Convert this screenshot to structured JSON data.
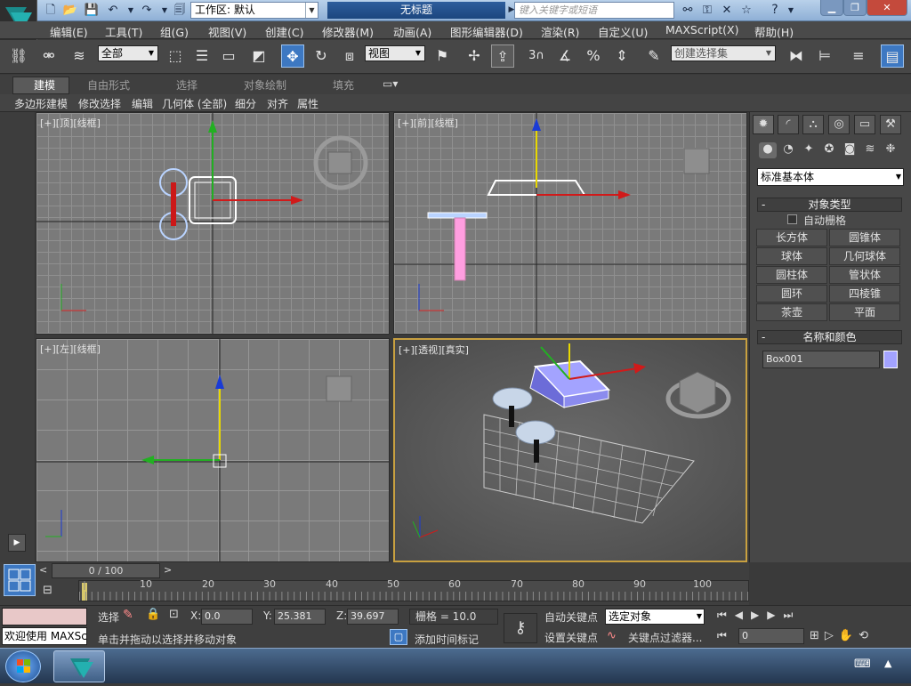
{
  "titlebar": {
    "workspace_label": "工作区: 默认",
    "doc_title": "无标题",
    "search_placeholder": "键入关键字或短语"
  },
  "menu": [
    "编辑(E)",
    "工具(T)",
    "组(G)",
    "视图(V)",
    "创建(C)",
    "修改器(M)",
    "动画(A)",
    "图形编辑器(D)",
    "渲染(R)",
    "自定义(U)",
    "MAXScript(X)",
    "帮助(H)"
  ],
  "toolbar": {
    "filter_select": "全部",
    "refcoord_select": "视图",
    "snap_label": "3",
    "selset_placeholder": "创建选择集"
  },
  "ribbon": {
    "tabs": [
      "建模",
      "自由形式",
      "选择",
      "对象绘制",
      "填充"
    ],
    "subtabs": [
      "多边形建模",
      "修改选择",
      "编辑",
      "几何体 (全部)",
      "细分",
      "对齐",
      "属性"
    ]
  },
  "viewports": {
    "top": "[+][顶][线框]",
    "front": "[+][前][线框]",
    "left": "[+][左][线框]",
    "persp": "[+][透视][真实]"
  },
  "viewcube": {
    "top": "上",
    "front": "前",
    "left": "左"
  },
  "panel": {
    "category": "标准基本体",
    "rollout_object_type": "对象类型",
    "autogrid": "自动栅格",
    "buttons": [
      "长方体",
      "圆锥体",
      "球体",
      "几何球体",
      "圆柱体",
      "管状体",
      "圆环",
      "四棱锥",
      "茶壶",
      "平面"
    ],
    "rollout_name_color": "名称和颜色",
    "object_name": "Box001",
    "object_color": "#a3a3ff"
  },
  "timeline": {
    "slider_label": "0 / 100",
    "ticks": [
      "10",
      "20",
      "30",
      "40",
      "50",
      "60",
      "70",
      "80",
      "90",
      "100"
    ]
  },
  "status": {
    "welcome": "欢迎使用 MAXSc",
    "select_label": "选择",
    "x_label": "X:",
    "x_value": "0.0",
    "y_label": "Y:",
    "y_value": "25.381",
    "z_label": "Z:",
    "z_value": "39.697",
    "grid": "栅格 = 10.0",
    "prompt": "单击并拖动以选择并移动对象",
    "add_time_tag": "添加时间标记",
    "auto_key": "自动关键点",
    "set_key": "设置关键点",
    "selected_object": "选定对象",
    "key_filter": "关键点过滤器...",
    "frame": "0"
  },
  "colors": {
    "accent_blue": "#2a70c8",
    "axis_x": "#d11a1a",
    "axis_y": "#22b022",
    "axis_z": "#1a3bd6",
    "selection_white": "#ffffff"
  }
}
